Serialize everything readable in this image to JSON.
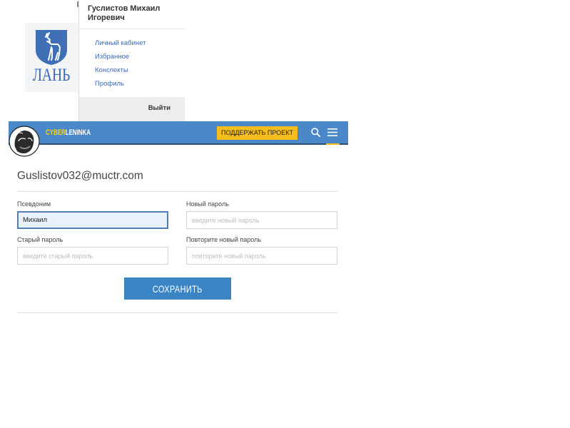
{
  "lan": {
    "logo_text": "ЛАНЬ"
  },
  "user_menu": {
    "name": "Гуслистов Михаил Игоревич",
    "items": [
      {
        "label": "Личный кабинет"
      },
      {
        "label": "Избранное"
      },
      {
        "label": "Конспекты"
      },
      {
        "label": "Профиль"
      }
    ],
    "logout_label": "Выйти"
  },
  "header": {
    "brand_prefix": "CYBER",
    "brand_suffix": "LENINKA",
    "support_label": "ПОДДЕРЖАТЬ ПРОЕКТ",
    "accent_color": "#f5be1c",
    "bar_color": "#4a88c9",
    "icons": [
      "search-icon",
      "menu-icon"
    ]
  },
  "profile": {
    "email": "Guslistov032@muctr.com",
    "nickname": {
      "label": "Псевдоним",
      "value": "Михаил"
    },
    "new_password": {
      "label": "Новый пароль",
      "placeholder": "введите новый пароль"
    },
    "old_password": {
      "label": "Старый пароль",
      "placeholder": "введите старый пароль"
    },
    "repeat_password": {
      "label": "Повторите новый пароль",
      "placeholder": "повторите новый пароль"
    },
    "save_label": "СОХРАНИТЬ"
  }
}
